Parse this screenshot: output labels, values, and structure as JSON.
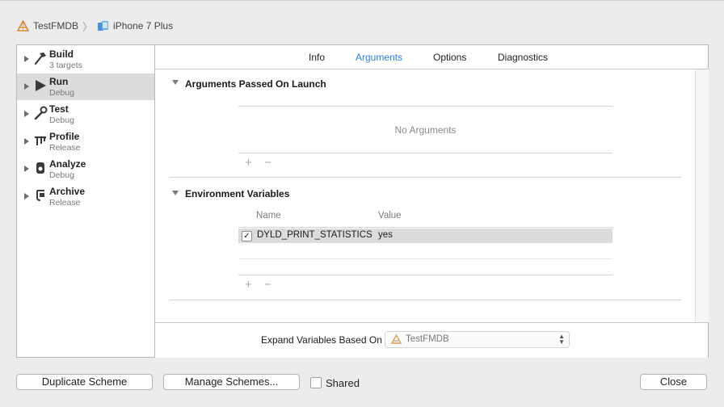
{
  "breadcrumb": {
    "project": "TestFMDB",
    "device": "iPhone 7 Plus",
    "separator": "〉"
  },
  "sidebar": {
    "items": [
      {
        "name": "Build",
        "sub": "3 targets",
        "icon": "hammer-icon",
        "selected": false
      },
      {
        "name": "Run",
        "sub": "Debug",
        "icon": "play-icon",
        "selected": true
      },
      {
        "name": "Test",
        "sub": "Debug",
        "icon": "wrench-icon",
        "selected": false
      },
      {
        "name": "Profile",
        "sub": "Release",
        "icon": "instruments-icon",
        "selected": false
      },
      {
        "name": "Analyze",
        "sub": "Debug",
        "icon": "analyze-icon",
        "selected": false
      },
      {
        "name": "Archive",
        "sub": "Release",
        "icon": "archive-icon",
        "selected": false
      }
    ]
  },
  "tabs": [
    {
      "label": "Info",
      "active": false
    },
    {
      "label": "Arguments",
      "active": true
    },
    {
      "label": "Options",
      "active": false
    },
    {
      "label": "Diagnostics",
      "active": false
    }
  ],
  "arguments": {
    "title": "Arguments Passed On Launch",
    "empty_message": "No Arguments",
    "add": "+",
    "remove": "−"
  },
  "environment": {
    "title": "Environment Variables",
    "columns": {
      "name": "Name",
      "value": "Value"
    },
    "rows": [
      {
        "checked": true,
        "check_mark": "✓",
        "name": "DYLD_PRINT_STATISTICS",
        "value": "yes"
      }
    ],
    "add": "+",
    "remove": "−"
  },
  "expand": {
    "label": "Expand Variables Based On",
    "selected": "TestFMDB",
    "arrows": "▲▼"
  },
  "footer": {
    "duplicate": "Duplicate Scheme",
    "manage": "Manage Schemes...",
    "shared_label": "Shared",
    "shared_checked": false,
    "close": "Close"
  },
  "colors": {
    "accent": "#2a7fe0",
    "selected_row": "#dcdcdc",
    "background": "#ececec"
  }
}
